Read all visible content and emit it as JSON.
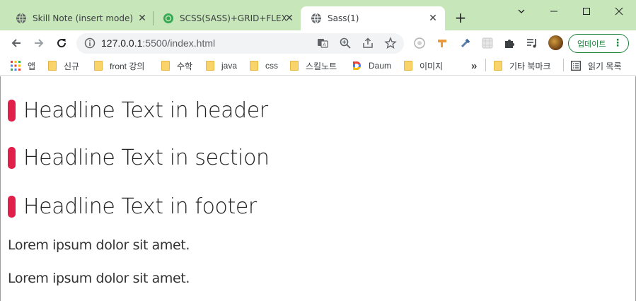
{
  "tabs": [
    {
      "title": "Skill Note (insert mode)",
      "icon": "globe-icon",
      "active": false
    },
    {
      "title": "SCSS(SASS)+GRID+FLEX 🌟",
      "icon": "gitmind-icon",
      "active": false
    },
    {
      "title": "Sass(1)",
      "icon": "globe-icon",
      "active": true
    }
  ],
  "toolbar": {
    "url_host": "127.0.0.1",
    "url_rest": ":5500/index.html",
    "update_label": "업데이트"
  },
  "bookmarks": {
    "apps_label": "앱",
    "items": [
      "신규",
      "front 강의",
      "수학",
      "java",
      "css",
      "스킬노트",
      "Daum",
      "이미지"
    ],
    "overflow": "»",
    "other_label": "기타 북마크",
    "reading_list": "읽기 목록"
  },
  "page": {
    "headlines": [
      "Headline Text in header",
      "Headline Text in section",
      "Headline Text in footer"
    ],
    "paragraphs": [
      "Lorem ipsum dolor sit amet.",
      "Lorem ipsum dolor sit amet."
    ],
    "accent_color": "#e0204a"
  },
  "colors": {
    "tabstrip_bg": "#c7e6b9",
    "update_green": "#188038"
  }
}
